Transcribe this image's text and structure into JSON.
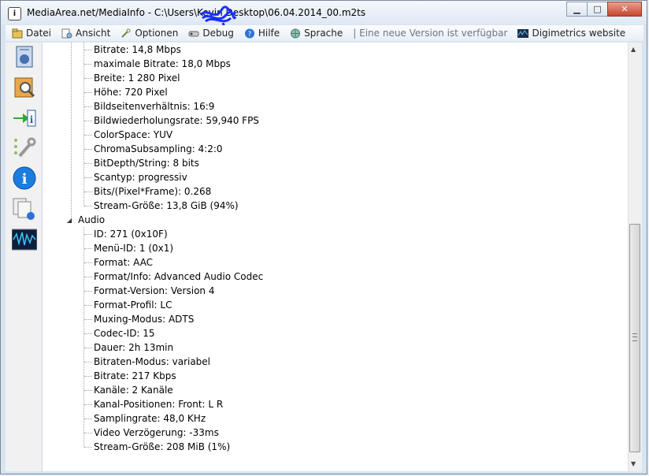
{
  "window": {
    "title": "MediaArea.net/MediaInfo - C:\\Users\\Kevin        Desktop\\06.04.2014_00.m2ts",
    "minimize": "▁",
    "maximize": "□",
    "close": "✕"
  },
  "menubar": [
    {
      "label": "Datei",
      "icon": "folder-icon"
    },
    {
      "label": "Ansicht",
      "icon": "view-icon"
    },
    {
      "label": "Optionen",
      "icon": "options-icon"
    },
    {
      "label": "Debug",
      "icon": "debug-icon"
    },
    {
      "label": "Hilfe",
      "icon": "help-icon"
    },
    {
      "label": "Sprache",
      "icon": "language-icon"
    },
    {
      "label": "| Eine neue Version ist verfügbar",
      "icon": ""
    },
    {
      "label": "Digimetrics website",
      "icon": "digimetrics-icon"
    }
  ],
  "sidebar": [
    "media-file-icon",
    "search-file-icon",
    "export-icon",
    "preferences-icon",
    "about-icon",
    "sheet-icon",
    "waveform-icon"
  ],
  "video_lines": [
    "Bitrate: 14,8 Mbps",
    "maximale Bitrate: 18,0 Mbps",
    "Breite: 1 280 Pixel",
    "Höhe: 720 Pixel",
    "Bildseitenverhältnis: 16:9",
    "Bildwiederholungsrate: 59,940 FPS",
    "ColorSpace: YUV",
    "ChromaSubsampling: 4:2:0",
    "BitDepth/String: 8 bits",
    "Scantyp: progressiv",
    "Bits/(Pixel*Frame): 0.268",
    "Stream-Größe: 13,8 GiB (94%)"
  ],
  "audio_header": "Audio",
  "audio_lines": [
    "ID: 271 (0x10F)",
    "Menü-ID: 1 (0x1)",
    "Format: AAC",
    "Format/Info: Advanced Audio Codec",
    "Format-Version: Version 4",
    "Format-Profil: LC",
    "Muxing-Modus: ADTS",
    "Codec-ID: 15",
    "Dauer: 2h 13min",
    "Bitraten-Modus: variabel",
    "Bitrate: 217 Kbps",
    "Kanäle: 2 Kanäle",
    "Kanal-Positionen: Front: L R",
    "Samplingrate: 48,0 KHz",
    "Video Verzögerung: -33ms",
    "Stream-Größe: 208 MiB (1%)"
  ]
}
